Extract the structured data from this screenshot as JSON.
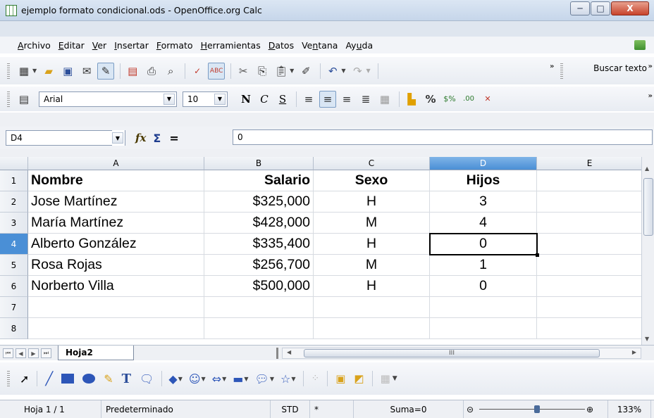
{
  "window": {
    "title": "ejemplo formato condicional.ods - OpenOffice.org Calc",
    "min_label": "─",
    "max_label": "□",
    "close_label": "X"
  },
  "menu": {
    "items": [
      "Archivo",
      "Editar",
      "Ver",
      "Insertar",
      "Formato",
      "Herramientas",
      "Datos",
      "Ventana",
      "Ayuda"
    ],
    "underline_index": [
      0,
      0,
      0,
      0,
      0,
      0,
      0,
      2,
      2
    ]
  },
  "toolbar": {
    "search_label": "Buscar texto",
    "font_name": "Arial",
    "font_size": "10",
    "bold_label": "N",
    "italic_label": "C",
    "underline_label": "S",
    "percent_label": "%"
  },
  "formula_bar": {
    "name_box": "D4",
    "fx_label": "fx",
    "sigma_label": "Σ",
    "equals_label": "=",
    "value": "0"
  },
  "grid": {
    "columns": [
      "A",
      "B",
      "C",
      "D",
      "E"
    ],
    "selected_column": "D",
    "rows": [
      "1",
      "2",
      "3",
      "4",
      "5",
      "6",
      "7",
      "8"
    ],
    "selected_row": "4",
    "cells": [
      [
        "Nombre",
        "Salario",
        "Sexo",
        "Hijos",
        ""
      ],
      [
        "Jose Martínez",
        "$325,000",
        "H",
        "3",
        ""
      ],
      [
        "María Martínez",
        "$428,000",
        "M",
        "4",
        ""
      ],
      [
        "Alberto González",
        "$335,400",
        "H",
        "0",
        ""
      ],
      [
        "Rosa Rojas",
        "$256,700",
        "M",
        "1",
        ""
      ],
      [
        "Norberto Villa",
        "$500,000",
        "H",
        "0",
        ""
      ],
      [
        "",
        "",
        "",
        "",
        ""
      ],
      [
        "",
        "",
        "",
        "",
        ""
      ]
    ],
    "active_cell": "D4"
  },
  "sheet_tabs": {
    "active": "Hoja2",
    "hscroll_label": "III"
  },
  "status_bar": {
    "sheet": "Hoja 1 / 1",
    "style": "Predeterminado",
    "mode": "STD",
    "modified": "*",
    "sum": "Suma=0",
    "zoom_minus": "⊝",
    "zoom_plus": "⊕",
    "zoom": "133%"
  },
  "colors": {
    "accent": "#4a8fd6",
    "titlebar": "#c6d6ea"
  }
}
